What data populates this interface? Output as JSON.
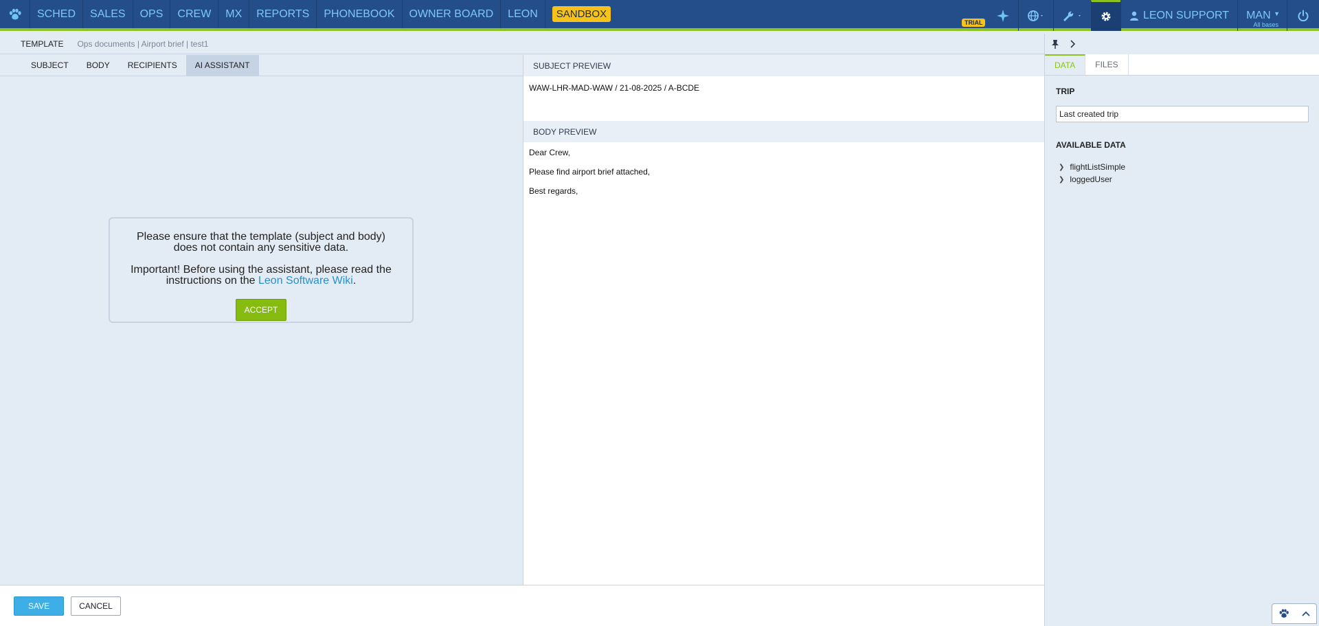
{
  "nav": {
    "items": [
      "SCHED",
      "SALES",
      "OPS",
      "CREW",
      "MX",
      "REPORTS",
      "PHONEBOOK",
      "OWNER BOARD",
      "LEON"
    ],
    "sandbox": "SANDBOX",
    "trial": "TRIAL",
    "user": "LEON SUPPORT",
    "base_code": "MAN",
    "base_sub": "All bases"
  },
  "breadcrumb": {
    "title": "TEMPLATE",
    "path": "Ops documents | Airport brief | test1"
  },
  "editor": {
    "tabs": [
      "SUBJECT",
      "BODY",
      "RECIPIENTS",
      "AI ASSISTANT"
    ],
    "active_tab": "AI ASSISTANT"
  },
  "consent": {
    "line1": "Please ensure that the template (subject and body) does not contain any sensitive data.",
    "line2_prefix": "Important! Before using the assistant, please read the instructions on the ",
    "link": "Leon Software Wiki",
    "line2_suffix": ".",
    "accept": "ACCEPT"
  },
  "preview": {
    "subject_header": "SUBJECT PREVIEW",
    "subject": "WAW-LHR-MAD-WAW / 21-08-2025 / A-BCDE",
    "body_header": "BODY PREVIEW",
    "body": [
      "Dear Crew,",
      "Please find airport brief attached,",
      "Best regards,"
    ]
  },
  "footer": {
    "save": "SAVE",
    "cancel": "CANCEL"
  },
  "right_panel": {
    "tabs": [
      "DATA",
      "FILES"
    ],
    "active_tab": "DATA",
    "trip_label": "TRIP",
    "trip_value": "Last created trip",
    "available_label": "AVAILABLE DATA",
    "available_items": [
      "flightListSimple",
      "loggedUser"
    ]
  },
  "colors": {
    "nav_bg": "#234e8a",
    "accent_green": "#8cc320",
    "sandbox_yellow": "#f7c219",
    "save_blue": "#3eaee6"
  }
}
